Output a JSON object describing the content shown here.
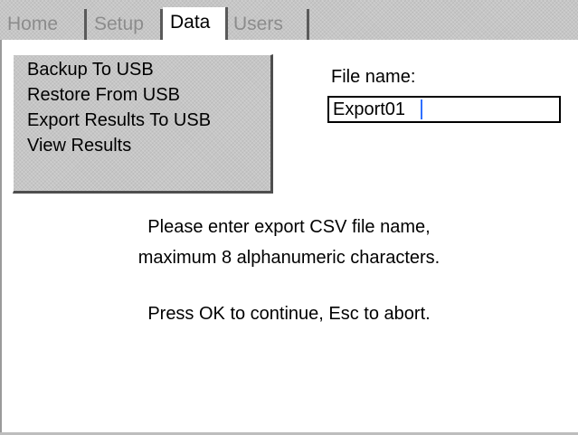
{
  "tabs": [
    {
      "label": "Home",
      "active": false
    },
    {
      "label": "Setup",
      "active": false
    },
    {
      "label": "Data",
      "active": true
    },
    {
      "label": "Users",
      "active": false
    }
  ],
  "menu": {
    "items": [
      {
        "label": "Backup To USB"
      },
      {
        "label": "Restore From USB"
      },
      {
        "label": "Export Results To USB"
      },
      {
        "label": "View Results"
      }
    ]
  },
  "file": {
    "label": "File name:",
    "value": "Export01"
  },
  "messages": {
    "line1": "Please enter export CSV file name,",
    "line2": "maximum 8 alphanumeric characters.",
    "line3": "Press OK to continue, Esc to abort."
  },
  "colors": {
    "panel_grey": "#c6c6c6",
    "inactive_tab_text": "#8c8c8c",
    "caret": "#2f6fff"
  }
}
